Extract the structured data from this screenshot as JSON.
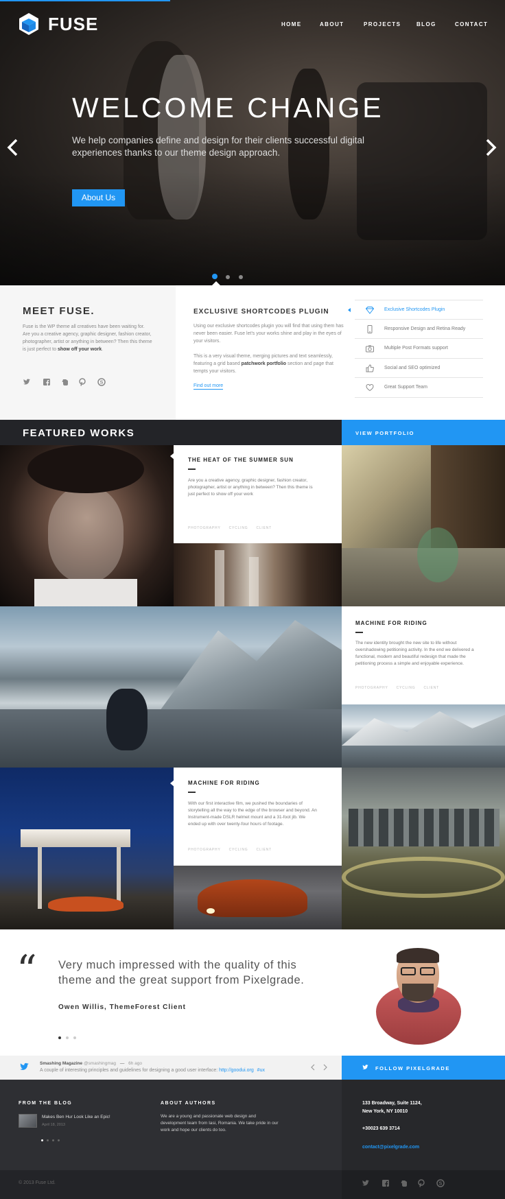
{
  "header": {
    "logo_text": "FUSE",
    "nav": [
      "HOME",
      "ABOUT",
      "PROJECTS",
      "BLOG",
      "CONTACT"
    ]
  },
  "hero": {
    "title": "WELCOME CHANGE",
    "subtitle": "We help companies define and design for their clients successful digital experiences thanks to our theme design approach.",
    "button": "About Us",
    "slides": 3,
    "active_slide": 1
  },
  "meet": {
    "title": "MEET FUSE.",
    "text_before": "Fuse is the WP theme all creatives have been waiting for. Are you a creative agency, graphic designer, fashion creator, photographer, artist or anything in between? Then this theme is just perfect to ",
    "text_bold": "show off your work",
    "text_after": ".",
    "social": [
      "twitter-icon",
      "facebook-icon",
      "evernote-icon",
      "pinterest-icon",
      "skype-icon"
    ]
  },
  "plugin": {
    "title": "EXCLUSIVE SHORTCODES PLUGIN",
    "p1": "Using our exclusive shortcodes plugin you will find that using them has never been easier. Fuse let's your works shine and play in the eyes of your visitors.",
    "p2_before": "This is a very visual theme, merging pictures and text seamlessly, featuring a grid based ",
    "p2_bold": "patchwork portfolio",
    "p2_after": " section and page that tempts your visitors.",
    "link": "Find out more"
  },
  "features": [
    {
      "label": "Exclusive Shortcodes Plugin",
      "icon": "diamond-icon",
      "active": true
    },
    {
      "label": "Responsive Design and Retina Ready",
      "icon": "phone-icon",
      "active": false
    },
    {
      "label": "Multiple Post Formats support",
      "icon": "camera-icon",
      "active": false
    },
    {
      "label": "Social and SEO optimized",
      "icon": "thumbs-up-icon",
      "active": false
    },
    {
      "label": "Great Support Team",
      "icon": "heart-icon",
      "active": false
    }
  ],
  "featured": {
    "title": "FEATURED WORKS",
    "view_portfolio": "VIEW PORTFOLIO",
    "works": [
      {
        "title": "THE HEAT OF THE SUMMER SUN",
        "text": "Are you a creative agency, graphic designer, fashion creator, photographer, artist or anything in between? Then this theme is just perfect to show off your work",
        "tags": [
          "PHOTOGRAPHY",
          "CYCLING",
          "CLIENT"
        ]
      },
      {
        "title": "MACHINE FOR RIDING",
        "text": "The new identity brought the new site to life without overshadowing petitioning activity. In the end we delivered a functional, modern and beautiful redesign that made the petitioning process a simple and enjoyable experience.",
        "tags": [
          "PHOTOGRAPHY",
          "CYCLING",
          "CLIENT"
        ]
      },
      {
        "title": "MACHINE FOR RIDING",
        "text": "With our first interactive film, we pushed the boundaries of storytelling all the way to the edge of the browser and beyond. An Instrument-made DSLR helmet mount and a 31-foot jib. We ended up with over twenty-four hours of footage.",
        "tags": [
          "PHOTOGRAPHY",
          "CYCLING",
          "CLIENT"
        ]
      }
    ]
  },
  "testimonial": {
    "quote": "Very much impressed with the quality of this theme and the great support from Pixelgrade.",
    "author": "Owen Willis, ThemeForest Client",
    "dots": 3,
    "active_dot": 0
  },
  "tweet": {
    "account": "Smashing Magazine",
    "handle": "@smashingmag",
    "separator": "—",
    "time": "6h ago",
    "text": "A couple of interesting principles and guidelines for designing a good user interface:",
    "link": "http://goodui.org",
    "hashtag": "#ux",
    "follow": "FOLLOW PIXELGRADE"
  },
  "footer": {
    "blog_title": "FROM THE BLOG",
    "blog_post": "Makes Ben Hur Look Like an Epic!",
    "blog_date": "April 18, 2013",
    "about_title": "ABOUT AUTHORS",
    "about_text": "We are a young and passionate web design and development team from Iasi, Romania. We take pride in our work and hope our clients do too.",
    "address_line1": "133 Broadway, Suite 1124,",
    "address_line2": "New York, NY 10010",
    "phone": "+30023 639 3714",
    "email": "contact@pixelgrade.com",
    "copyright": "© 2013 Fuse Ltd."
  },
  "colors": {
    "accent": "#2196f3",
    "dark": "#232428",
    "footer": "#2e2f33"
  }
}
